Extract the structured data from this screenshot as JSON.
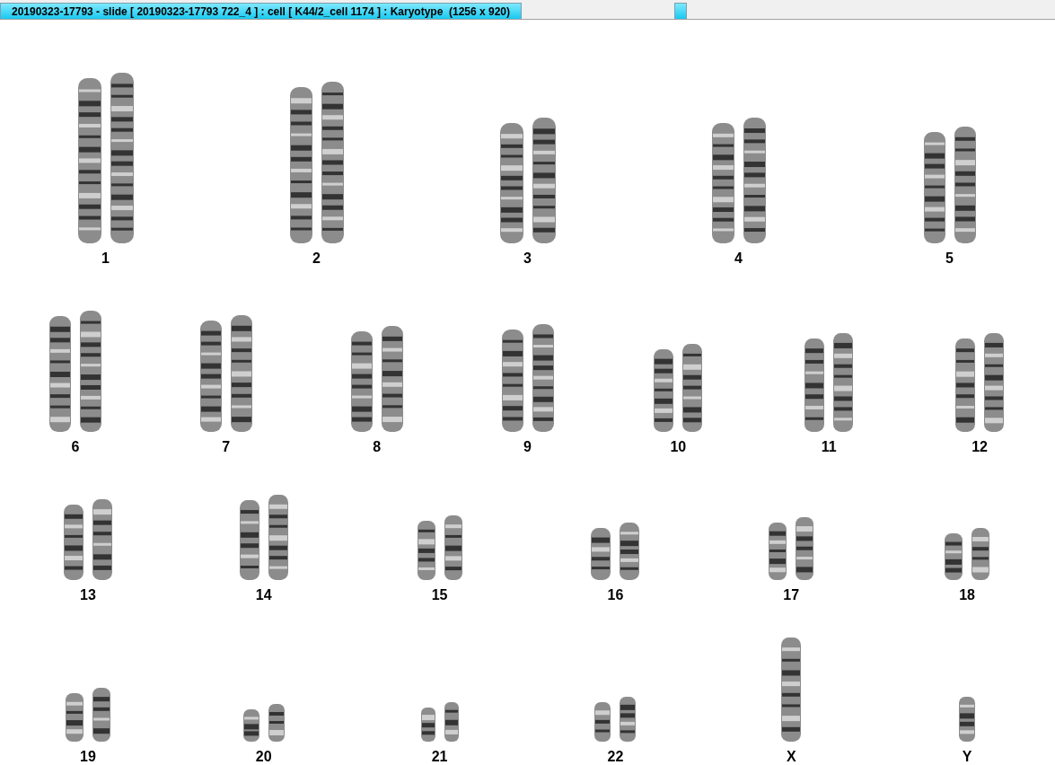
{
  "tabs": [
    {
      "label": "20190323-17793 - slide [ 20190323-17793 722_4 ] : cell [ K44/2_cell 1174 ] : Karyotype  (1256 x 920)",
      "selected": true
    }
  ],
  "karyotype": {
    "rows": [
      [
        {
          "label": "1",
          "kind": "pair"
        },
        {
          "label": "2",
          "kind": "pair"
        },
        {
          "label": "3",
          "kind": "pair"
        },
        {
          "label": "4",
          "kind": "pair"
        },
        {
          "label": "5",
          "kind": "pair"
        }
      ],
      [
        {
          "label": "6",
          "kind": "pair"
        },
        {
          "label": "7",
          "kind": "pair"
        },
        {
          "label": "8",
          "kind": "pair"
        },
        {
          "label": "9",
          "kind": "pair"
        },
        {
          "label": "10",
          "kind": "pair"
        },
        {
          "label": "11",
          "kind": "pair"
        },
        {
          "label": "12",
          "kind": "pair"
        }
      ],
      [
        {
          "label": "13",
          "kind": "pair"
        },
        {
          "label": "14",
          "kind": "pair"
        },
        {
          "label": "15",
          "kind": "pair"
        },
        {
          "label": "16",
          "kind": "pair"
        },
        {
          "label": "17",
          "kind": "pair"
        },
        {
          "label": "18",
          "kind": "pair"
        }
      ],
      [
        {
          "label": "19",
          "kind": "pair"
        },
        {
          "label": "20",
          "kind": "pair"
        },
        {
          "label": "21",
          "kind": "pair"
        },
        {
          "label": "22",
          "kind": "pair"
        },
        {
          "label": "X",
          "kind": "single"
        },
        {
          "label": "Y",
          "kind": "single"
        }
      ]
    ]
  }
}
